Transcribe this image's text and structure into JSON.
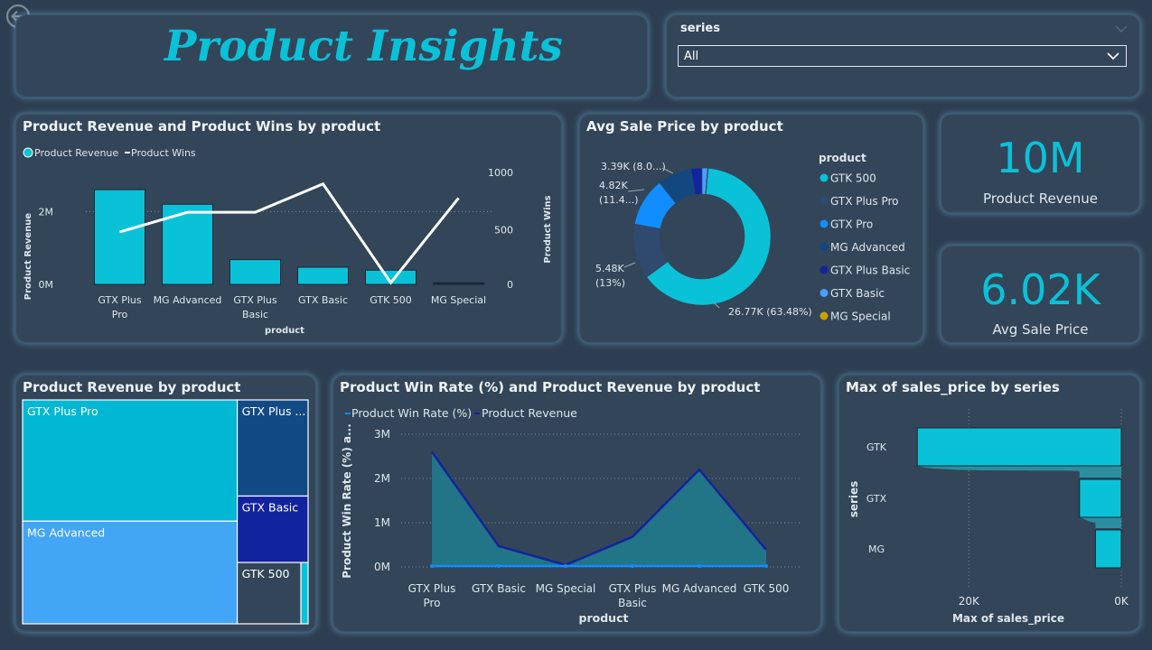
{
  "header": {
    "title": "Product Insights"
  },
  "back_icon": "arrow-left-circle-icon",
  "slicer": {
    "label": "series",
    "selected": "All",
    "chevron": "chevron-down-icon"
  },
  "colors": {
    "accent": "#0ac2d8",
    "bg": "#2e3e52",
    "card": "#334559",
    "dark_blue": "#12239e",
    "mid_blue": "#1a4f8a"
  },
  "kpis": [
    {
      "value": "10M",
      "label": "Product Revenue"
    },
    {
      "value": "6.02K",
      "label": "Avg Sale Price"
    }
  ],
  "chart_data": [
    {
      "type": "bar+line",
      "title": "Product Revenue and Product Wins by product",
      "xlabel": "product",
      "ylabel": "Product Revenue",
      "y2label": "Product Wins",
      "legend": [
        "Product Revenue",
        "Product Wins"
      ],
      "categories": [
        "GTX Plus Pro",
        "MG Advanced",
        "GTX Plus Basic",
        "GTX Basic",
        "GTK 500",
        "MG Special"
      ],
      "series": [
        {
          "name": "Product Revenue",
          "values": [
            2600000,
            2200000,
            680000,
            470000,
            390000,
            44000
          ]
        },
        {
          "name": "Product Wins",
          "values": [
            480,
            660,
            660,
            920,
            15,
            790
          ]
        }
      ],
      "y_ticks": [
        "0M",
        "2M"
      ],
      "y2_ticks": [
        "0",
        "500",
        "1000"
      ],
      "ylim": [
        0,
        3000000
      ],
      "y2lim": [
        0,
        1000
      ]
    },
    {
      "type": "pie",
      "title": "Avg Sale Price by product",
      "legend_title": "product",
      "legend": [
        "GTK 500",
        "GTX Plus Pro",
        "GTX Pro",
        "MG Advanced",
        "GTX Plus Basic",
        "GTX Basic",
        "MG Special"
      ],
      "values": [
        26770,
        5480,
        4820,
        3390,
        1090,
        550,
        55
      ],
      "labels": [
        "26.77K (63.48%)",
        "5.48K (13%)",
        "4.82K (11.4...)",
        "3.39K (8.0...)",
        "",
        "",
        ""
      ],
      "colors": [
        "#0ac2d8",
        "#2f4a6e",
        "#118dff",
        "#12477f",
        "#12239e",
        "#4a9eff",
        "#c8a300"
      ]
    },
    {
      "type": "treemap",
      "title": "Product Revenue by product",
      "categories": [
        "GTX Plus Pro",
        "MG Advanced",
        "GTX Plus Basic",
        "GTX Basic",
        "GTK 500",
        "MG Special"
      ],
      "labels": [
        "GTX Plus Pro",
        "MG Advanced",
        "GTX Plus ...",
        "GTX Basic",
        "GTK 500",
        ""
      ],
      "values": [
        2600000,
        2200000,
        680000,
        470000,
        390000,
        44000
      ]
    },
    {
      "type": "area",
      "title": "Product Win Rate (%) and Product Revenue by product",
      "xlabel": "product",
      "ylabel": "Product Win Rate (%) a...",
      "legend": [
        "Product Win Rate (%)",
        "Product Revenue"
      ],
      "categories": [
        "GTX Plus Pro",
        "GTX Basic",
        "MG Special",
        "GTX Plus Basic",
        "MG Advanced",
        "GTK 500"
      ],
      "series": [
        {
          "name": "Product Revenue",
          "values": [
            2600000,
            470000,
            44000,
            680000,
            2200000,
            390000
          ]
        },
        {
          "name": "Product Win Rate (%)",
          "values": [
            0.65,
            0.62,
            0.63,
            0.63,
            0.64,
            0.63
          ]
        }
      ],
      "y_ticks": [
        "0M",
        "1M",
        "2M",
        "3M"
      ],
      "ylim": [
        0,
        3000000
      ]
    },
    {
      "type": "bar",
      "title": "Max of sales_price by series",
      "xlabel": "Max of sales_price",
      "ylabel": "series",
      "categories": [
        "GTK",
        "GTX",
        "MG"
      ],
      "values": [
        26770,
        5480,
        3390
      ],
      "x_ticks": [
        "20K",
        "0K"
      ],
      "xlim": [
        0,
        30000
      ]
    }
  ]
}
